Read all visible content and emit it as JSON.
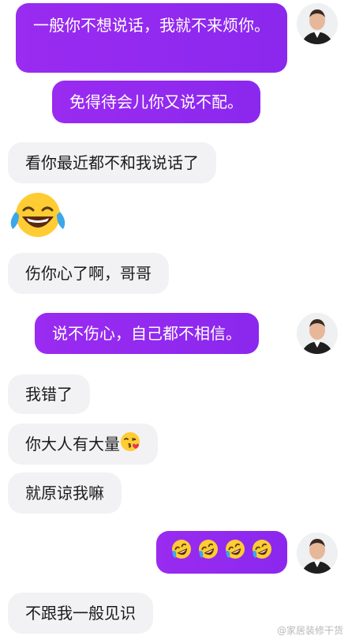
{
  "messages": [
    {
      "side": "out",
      "text": "一般你不想说话，我就不来烦你。"
    },
    {
      "side": "out",
      "text": "免得待会儿你又说不配。"
    },
    {
      "side": "in",
      "text": "看你最近都不和我说话了"
    },
    {
      "side": "in",
      "emoji": "laugh-cry-emoji"
    },
    {
      "side": "in",
      "text": "伤你心了啊，哥哥"
    },
    {
      "side": "out",
      "text": "说不伤心，自己都不相信。"
    },
    {
      "side": "in",
      "text": "我错了"
    },
    {
      "side": "in",
      "text": "你大人有大量",
      "emoji": "kiss-emoji"
    },
    {
      "side": "in",
      "text": "就原谅我嘛"
    },
    {
      "side": "out",
      "emoji_sequence": [
        "rofl-emoji",
        "rofl-emoji",
        "rofl-emoji",
        "rofl-emoji"
      ]
    },
    {
      "side": "in",
      "text": "不跟我一般见识"
    }
  ],
  "avatar_icon": "man-avatar-icon",
  "colors": {
    "outgoing_bubble": "#9a2bf0",
    "incoming_bubble": "#f2f2f4",
    "outgoing_text": "#ffffff",
    "incoming_text": "#1a1a1a"
  },
  "watermark": "@家居装修干货"
}
